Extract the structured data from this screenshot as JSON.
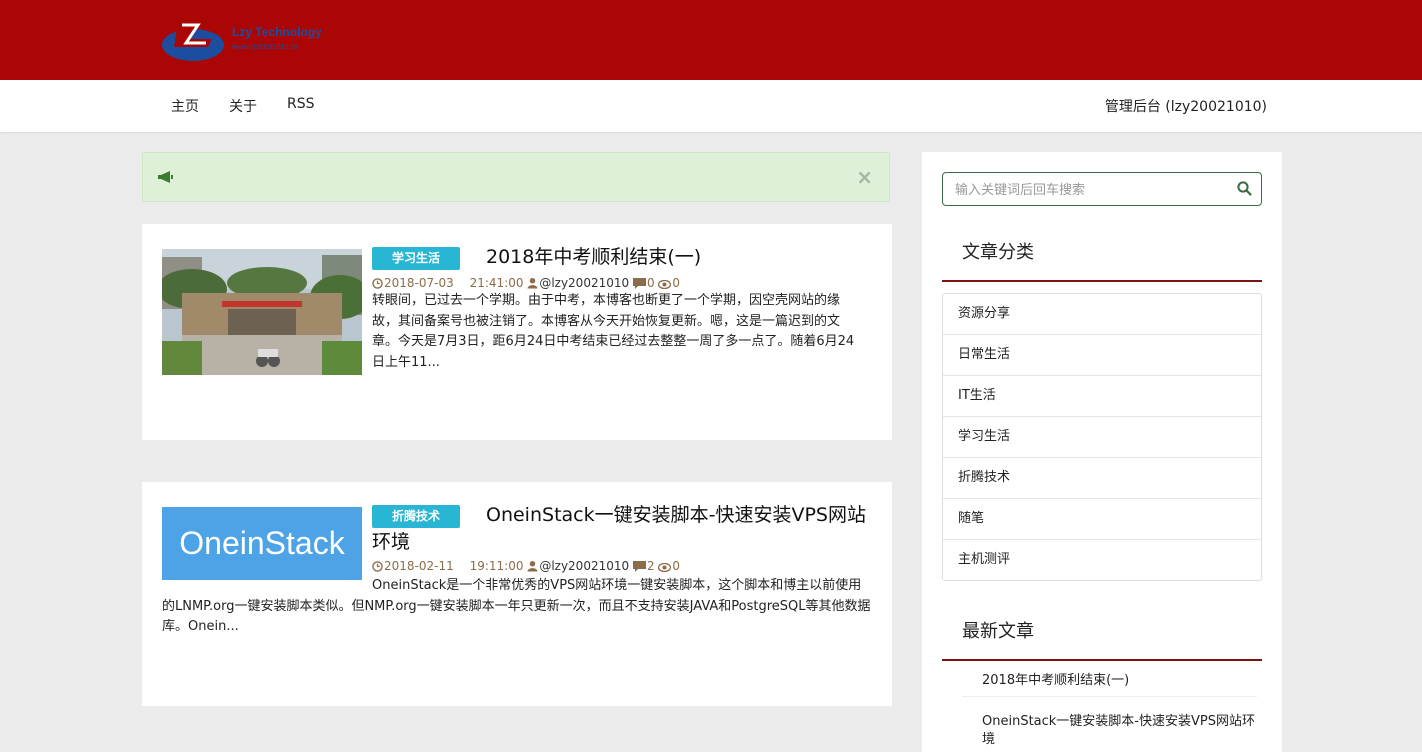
{
  "brand": {
    "title": "Lzy Technology",
    "subtitle": "www.lzy20021010.cn",
    "colors": {
      "header": "#ab0606",
      "logo": "#1d4d9e"
    }
  },
  "nav": {
    "items": [
      {
        "label": "主页"
      },
      {
        "label": "关于"
      },
      {
        "label": "RSS"
      }
    ],
    "admin_label": "管理后台 (lzy20021010)"
  },
  "notice": {
    "icon": "megaphone-icon",
    "close_label": "×"
  },
  "posts": [
    {
      "category": "学习生活",
      "title": "2018年中考顺利结束(一)",
      "date": "2018-07-03",
      "time": "21:41:00",
      "author": "@lzy20021010",
      "comments": "0",
      "views": "0",
      "excerpt": "转眼间，已过去一个学期。由于中考，本博客也断更了一个学期，因空壳网站的缘故，其间备案号也被注销了。本博客从今天开始恢复更新。嗯，这是一篇迟到的文章。今天是7月3日，距6月24日中考结束已经过去整整一周了多一点了。随着6月24日上午11..."
    },
    {
      "category": "折腾技术",
      "title": "OneinStack一键安装脚本-快速安装VPS网站环境",
      "thumb_text": "OneinStack",
      "date": "2018-02-11",
      "time": "19:11:00",
      "author": "@lzy20021010",
      "comments": "2",
      "views": "0",
      "excerpt": "OneinStack是一个非常优秀的VPS网站环境一键安装脚本，这个脚本和博主以前使用的LNMP.org一键安装脚本类似。但NMP.org一键安装脚本一年只更新一次，而且不支持安装JAVA和PostgreSQL等其他数据库。Onein..."
    }
  ],
  "sidebar": {
    "search_placeholder": "输入关键词后回车搜索",
    "categories_heading": "文章分类",
    "categories": [
      {
        "label": "资源分享"
      },
      {
        "label": "日常生活"
      },
      {
        "label": "IT生活"
      },
      {
        "label": "学习生活"
      },
      {
        "label": "折腾技术"
      },
      {
        "label": "随笔"
      },
      {
        "label": "主机测评"
      }
    ],
    "recent_heading": "最新文章",
    "recent": [
      {
        "label": "2018年中考顺利结束(一)"
      },
      {
        "label": "OneinStack一键安装脚本-快速安装VPS网站环境"
      }
    ]
  }
}
